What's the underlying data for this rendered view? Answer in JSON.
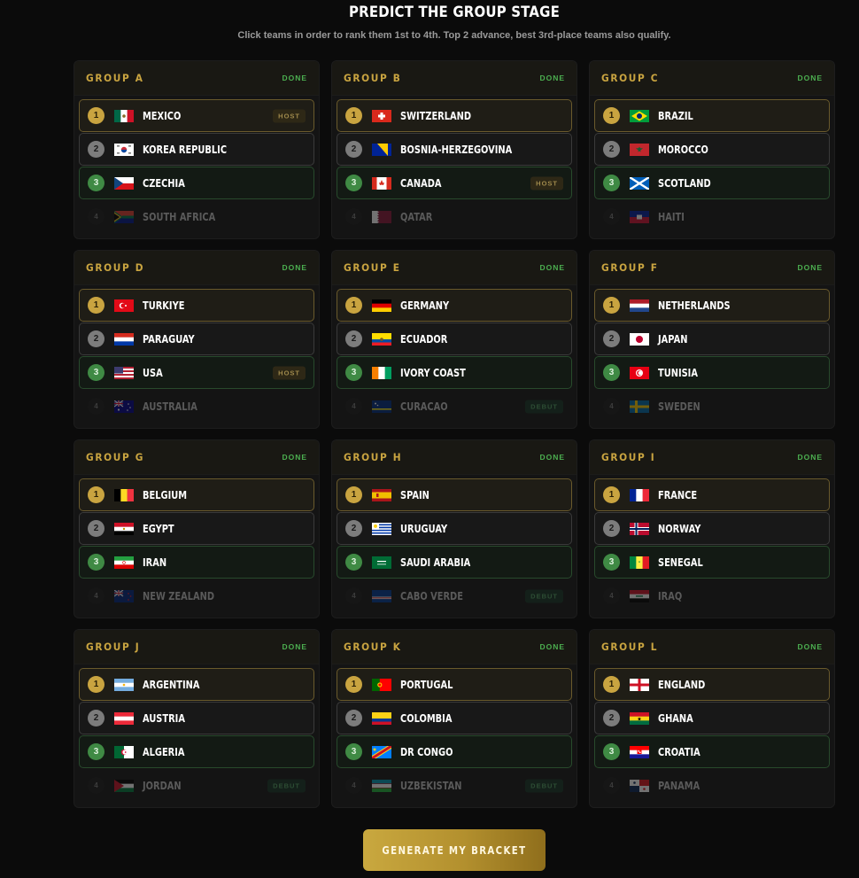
{
  "page": {
    "title": "PREDICT THE GROUP STAGE",
    "subtitle": "Click teams in order to rank them 1st to 4th. Top 2 advance, best 3rd-place teams also qualify.",
    "cta_label": "GENERATE MY BRACKET"
  },
  "colors": {
    "gold": "#c9a440",
    "green": "#4caf50",
    "background": "#0b0b0b"
  },
  "groups": [
    {
      "name": "GROUP A",
      "status": "DONE",
      "teams": [
        {
          "rank": "1",
          "name": "MEXICO",
          "flag": "mexico-flag-icon",
          "tag": "HOST"
        },
        {
          "rank": "2",
          "name": "KOREA REPUBLIC",
          "flag": "korea-flag-icon",
          "tag": ""
        },
        {
          "rank": "3",
          "name": "CZECHIA",
          "flag": "czechia-flag-icon",
          "tag": ""
        },
        {
          "rank": "4",
          "name": "SOUTH AFRICA",
          "flag": "south-africa-flag-icon",
          "tag": ""
        }
      ]
    },
    {
      "name": "GROUP B",
      "status": "DONE",
      "teams": [
        {
          "rank": "1",
          "name": "SWITZERLAND",
          "flag": "switzerland-flag-icon",
          "tag": ""
        },
        {
          "rank": "2",
          "name": "BOSNIA-HERZEGOVINA",
          "flag": "bosnia-flag-icon",
          "tag": ""
        },
        {
          "rank": "3",
          "name": "CANADA",
          "flag": "canada-flag-icon",
          "tag": "HOST"
        },
        {
          "rank": "4",
          "name": "QATAR",
          "flag": "qatar-flag-icon",
          "tag": ""
        }
      ]
    },
    {
      "name": "GROUP C",
      "status": "DONE",
      "teams": [
        {
          "rank": "1",
          "name": "BRAZIL",
          "flag": "brazil-flag-icon",
          "tag": ""
        },
        {
          "rank": "2",
          "name": "MOROCCO",
          "flag": "morocco-flag-icon",
          "tag": ""
        },
        {
          "rank": "3",
          "name": "SCOTLAND",
          "flag": "scotland-flag-icon",
          "tag": ""
        },
        {
          "rank": "4",
          "name": "HAITI",
          "flag": "haiti-flag-icon",
          "tag": ""
        }
      ]
    },
    {
      "name": "GROUP D",
      "status": "DONE",
      "teams": [
        {
          "rank": "1",
          "name": "TURKIYE",
          "flag": "turkiye-flag-icon",
          "tag": ""
        },
        {
          "rank": "2",
          "name": "PARAGUAY",
          "flag": "paraguay-flag-icon",
          "tag": ""
        },
        {
          "rank": "3",
          "name": "USA",
          "flag": "usa-flag-icon",
          "tag": "HOST"
        },
        {
          "rank": "4",
          "name": "AUSTRALIA",
          "flag": "australia-flag-icon",
          "tag": ""
        }
      ]
    },
    {
      "name": "GROUP E",
      "status": "DONE",
      "teams": [
        {
          "rank": "1",
          "name": "GERMANY",
          "flag": "germany-flag-icon",
          "tag": ""
        },
        {
          "rank": "2",
          "name": "ECUADOR",
          "flag": "ecuador-flag-icon",
          "tag": ""
        },
        {
          "rank": "3",
          "name": "IVORY COAST",
          "flag": "ivory-coast-flag-icon",
          "tag": ""
        },
        {
          "rank": "4",
          "name": "CURACAO",
          "flag": "curacao-flag-icon",
          "tag": "DEBUT"
        }
      ]
    },
    {
      "name": "GROUP F",
      "status": "DONE",
      "teams": [
        {
          "rank": "1",
          "name": "NETHERLANDS",
          "flag": "netherlands-flag-icon",
          "tag": ""
        },
        {
          "rank": "2",
          "name": "JAPAN",
          "flag": "japan-flag-icon",
          "tag": ""
        },
        {
          "rank": "3",
          "name": "TUNISIA",
          "flag": "tunisia-flag-icon",
          "tag": ""
        },
        {
          "rank": "4",
          "name": "SWEDEN",
          "flag": "sweden-flag-icon",
          "tag": ""
        }
      ]
    },
    {
      "name": "GROUP G",
      "status": "DONE",
      "teams": [
        {
          "rank": "1",
          "name": "BELGIUM",
          "flag": "belgium-flag-icon",
          "tag": ""
        },
        {
          "rank": "2",
          "name": "EGYPT",
          "flag": "egypt-flag-icon",
          "tag": ""
        },
        {
          "rank": "3",
          "name": "IRAN",
          "flag": "iran-flag-icon",
          "tag": ""
        },
        {
          "rank": "4",
          "name": "NEW ZEALAND",
          "flag": "new-zealand-flag-icon",
          "tag": ""
        }
      ]
    },
    {
      "name": "GROUP H",
      "status": "DONE",
      "teams": [
        {
          "rank": "1",
          "name": "SPAIN",
          "flag": "spain-flag-icon",
          "tag": ""
        },
        {
          "rank": "2",
          "name": "URUGUAY",
          "flag": "uruguay-flag-icon",
          "tag": ""
        },
        {
          "rank": "3",
          "name": "SAUDI ARABIA",
          "flag": "saudi-arabia-flag-icon",
          "tag": ""
        },
        {
          "rank": "4",
          "name": "CABO VERDE",
          "flag": "cabo-verde-flag-icon",
          "tag": "DEBUT"
        }
      ]
    },
    {
      "name": "GROUP I",
      "status": "DONE",
      "teams": [
        {
          "rank": "1",
          "name": "FRANCE",
          "flag": "france-flag-icon",
          "tag": ""
        },
        {
          "rank": "2",
          "name": "NORWAY",
          "flag": "norway-flag-icon",
          "tag": ""
        },
        {
          "rank": "3",
          "name": "SENEGAL",
          "flag": "senegal-flag-icon",
          "tag": ""
        },
        {
          "rank": "4",
          "name": "IRAQ",
          "flag": "iraq-flag-icon",
          "tag": ""
        }
      ]
    },
    {
      "name": "GROUP J",
      "status": "DONE",
      "teams": [
        {
          "rank": "1",
          "name": "ARGENTINA",
          "flag": "argentina-flag-icon",
          "tag": ""
        },
        {
          "rank": "2",
          "name": "AUSTRIA",
          "flag": "austria-flag-icon",
          "tag": ""
        },
        {
          "rank": "3",
          "name": "ALGERIA",
          "flag": "algeria-flag-icon",
          "tag": ""
        },
        {
          "rank": "4",
          "name": "JORDAN",
          "flag": "jordan-flag-icon",
          "tag": "DEBUT"
        }
      ]
    },
    {
      "name": "GROUP K",
      "status": "DONE",
      "teams": [
        {
          "rank": "1",
          "name": "PORTUGAL",
          "flag": "portugal-flag-icon",
          "tag": ""
        },
        {
          "rank": "2",
          "name": "COLOMBIA",
          "flag": "colombia-flag-icon",
          "tag": ""
        },
        {
          "rank": "3",
          "name": "DR CONGO",
          "flag": "dr-congo-flag-icon",
          "tag": ""
        },
        {
          "rank": "4",
          "name": "UZBEKISTAN",
          "flag": "uzbekistan-flag-icon",
          "tag": "DEBUT"
        }
      ]
    },
    {
      "name": "GROUP L",
      "status": "DONE",
      "teams": [
        {
          "rank": "1",
          "name": "ENGLAND",
          "flag": "england-flag-icon",
          "tag": ""
        },
        {
          "rank": "2",
          "name": "GHANA",
          "flag": "ghana-flag-icon",
          "tag": ""
        },
        {
          "rank": "3",
          "name": "CROATIA",
          "flag": "croatia-flag-icon",
          "tag": ""
        },
        {
          "rank": "4",
          "name": "PANAMA",
          "flag": "panama-flag-icon",
          "tag": ""
        }
      ]
    }
  ]
}
